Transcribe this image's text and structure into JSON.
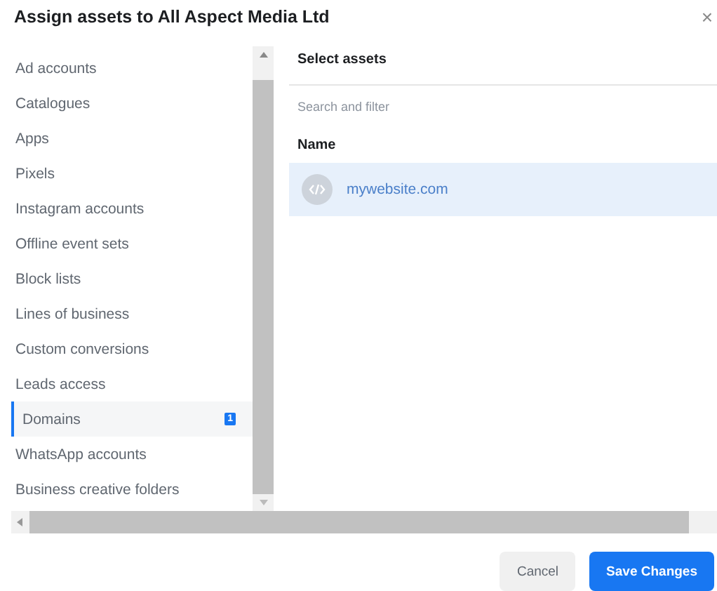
{
  "window": {
    "title": "Assign assets to All Aspect Media Ltd",
    "close": "×"
  },
  "sidebar": {
    "items": [
      {
        "label": "Ad accounts",
        "selected": false
      },
      {
        "label": "Catalogues",
        "selected": false
      },
      {
        "label": "Apps",
        "selected": false
      },
      {
        "label": "Pixels",
        "selected": false
      },
      {
        "label": "Instagram accounts",
        "selected": false
      },
      {
        "label": "Offline event sets",
        "selected": false
      },
      {
        "label": "Block lists",
        "selected": false
      },
      {
        "label": "Lines of business",
        "selected": false
      },
      {
        "label": "Custom conversions",
        "selected": false
      },
      {
        "label": "Leads access",
        "selected": false
      },
      {
        "label": "Domains",
        "selected": true,
        "badge": "1"
      },
      {
        "label": "WhatsApp accounts",
        "selected": false
      },
      {
        "label": "Business creative folders",
        "selected": false
      }
    ]
  },
  "panel": {
    "heading": "Select assets",
    "search": {
      "placeholder": "Search and filter"
    },
    "column": "Name",
    "rows": [
      {
        "name": "mywebsite.com",
        "selected": true
      }
    ]
  },
  "buttons": [
    {
      "label": "Cancel",
      "kind": "secondary"
    },
    {
      "label": "Save Changes",
      "kind": "primary"
    }
  ]
}
